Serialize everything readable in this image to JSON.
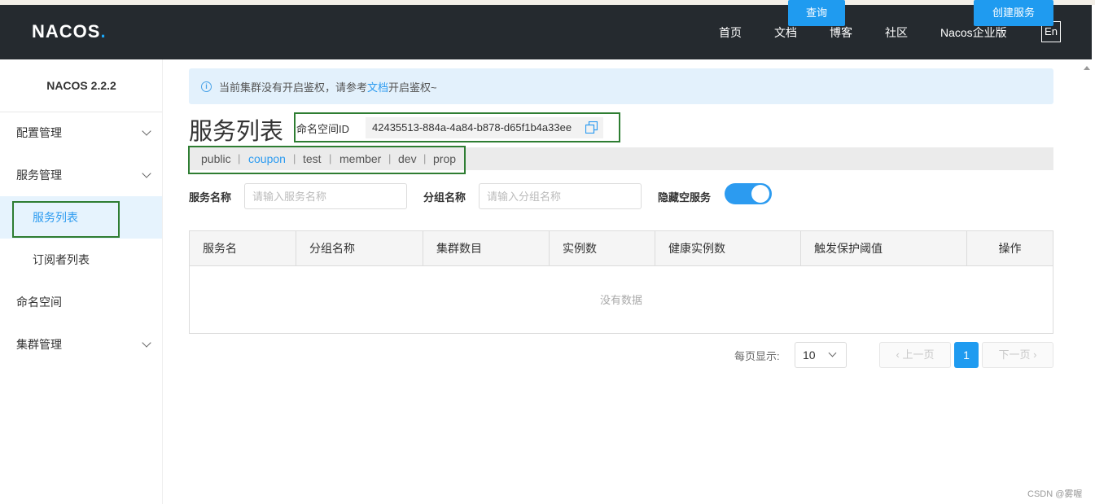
{
  "header": {
    "logo_text": "NACOS",
    "logo_dot": ".",
    "nav": [
      "首页",
      "文档",
      "博客",
      "社区",
      "Nacos企业版"
    ],
    "lang_button": "En"
  },
  "sidebar": {
    "version": "NACOS 2.2.2",
    "items": [
      {
        "label": "配置管理",
        "expandable": true
      },
      {
        "label": "服务管理",
        "expandable": true
      },
      {
        "label": "服务列表",
        "active": true,
        "sub": true
      },
      {
        "label": "订阅者列表",
        "sub": true
      },
      {
        "label": "命名空间"
      },
      {
        "label": "集群管理",
        "expandable": true
      }
    ]
  },
  "notice": {
    "text_before": "当前集群没有开启鉴权，请参考",
    "link": "文档",
    "text_after": "开启鉴权~"
  },
  "page": {
    "title": "服务列表",
    "namespace_label": "命名空间ID",
    "namespace_id": "42435513-884a-4a84-b878-d65f1b4a33ee"
  },
  "namespaces": {
    "tabs": [
      "public",
      "coupon",
      "test",
      "member",
      "dev",
      "prop"
    ],
    "active": "coupon",
    "separator": "|"
  },
  "filters": {
    "service_name_label": "服务名称",
    "service_name_placeholder": "请输入服务名称",
    "group_name_label": "分组名称",
    "group_name_placeholder": "请输入分组名称",
    "hide_empty_label": "隐藏空服务",
    "hide_empty_on": true,
    "query_button": "查询",
    "create_button": "创建服务"
  },
  "table": {
    "columns": [
      "服务名",
      "分组名称",
      "集群数目",
      "实例数",
      "健康实例数",
      "触发保护阈值",
      "操作"
    ],
    "empty_text": "没有数据"
  },
  "pagination": {
    "page_size_label": "每页显示:",
    "page_size": "10",
    "prev": "上一页",
    "next": "下一页",
    "current_page": "1"
  },
  "watermark": "CSDN @雾喔",
  "colors": {
    "header_bg": "#252a2f",
    "accent": "#1f9bf0",
    "highlight_box": "#2e7d32"
  }
}
